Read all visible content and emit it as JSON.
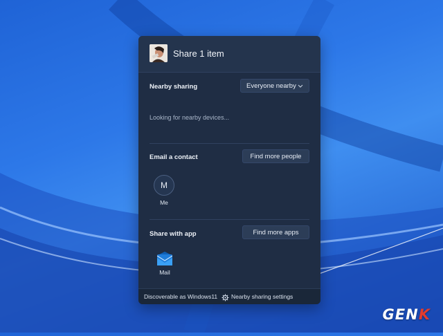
{
  "header": {
    "title": "Share 1 item"
  },
  "nearby": {
    "label": "Nearby sharing",
    "dropdown_value": "Everyone nearby",
    "status": "Looking for nearby devices..."
  },
  "email": {
    "label": "Email a contact",
    "button": "Find more people",
    "contacts": [
      {
        "initial": "M",
        "name": "Me"
      }
    ]
  },
  "apps": {
    "label": "Share with app",
    "button": "Find more apps",
    "items": [
      {
        "name": "Mail",
        "icon": "mail-icon"
      }
    ]
  },
  "footer": {
    "discoverable": "Discoverable as Windows11",
    "settings": "Nearby sharing settings"
  },
  "watermark": {
    "text": "GEN",
    "accent": "K"
  },
  "colors": {
    "dialog_bg": "#1f2d44",
    "accent_red": "#e23b2e",
    "mail_blue": "#2b8ae6"
  }
}
